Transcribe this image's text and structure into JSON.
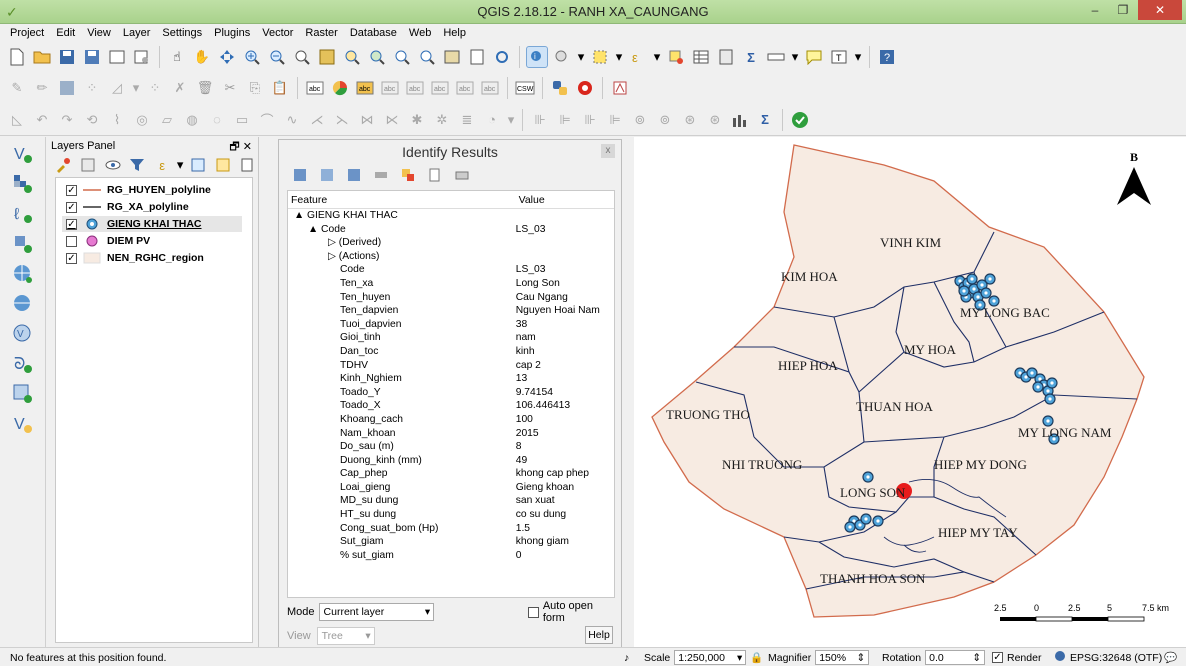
{
  "window": {
    "title": "QGIS 2.18.12 - RANH XA_CAUNGANG",
    "min": "–",
    "max": "❐",
    "close": "✕"
  },
  "menu": [
    "Project",
    "Edit",
    "View",
    "Layer",
    "Settings",
    "Plugins",
    "Vector",
    "Raster",
    "Database",
    "Web",
    "Help"
  ],
  "layers_panel": {
    "title": "Layers Panel",
    "controls": "🗗 ✕",
    "layers": [
      {
        "name": "RG_HUYEN_polyline",
        "checked": true,
        "symbol": "line",
        "color": "#d26b4c"
      },
      {
        "name": "RG_XA_polyline",
        "checked": true,
        "symbol": "line",
        "color": "#333333"
      },
      {
        "name": "GIENG KHAI THAC",
        "checked": true,
        "symbol": "point",
        "color": "#4fa3d9"
      },
      {
        "name": "DIEM PV",
        "checked": false,
        "symbol": "point",
        "color": "#e67ad1"
      },
      {
        "name": "NEN_RGHC_region",
        "checked": true,
        "symbol": "fill",
        "color": "#f7ebe2"
      }
    ]
  },
  "identify": {
    "title": "Identify Results",
    "close": "x",
    "col_feature": "Feature",
    "col_value": "Value",
    "rows": [
      {
        "k": "▲ GIENG KHAI THAC",
        "v": "",
        "indent": 6
      },
      {
        "k": "▲ Code",
        "v": "LS_03",
        "indent": 20
      },
      {
        "k": "▷ (Derived)",
        "v": "",
        "indent": 40
      },
      {
        "k": "▷ (Actions)",
        "v": "",
        "indent": 40
      },
      {
        "k": "Code",
        "v": "LS_03",
        "indent": 52
      },
      {
        "k": "Ten_xa",
        "v": "Long Son",
        "indent": 52
      },
      {
        "k": "Ten_huyen",
        "v": "Cau Ngang",
        "indent": 52
      },
      {
        "k": "Ten_dapvien",
        "v": "Nguyen Hoai Nam",
        "indent": 52
      },
      {
        "k": "Tuoi_dapvien",
        "v": "38",
        "indent": 52
      },
      {
        "k": "Gioi_tinh",
        "v": "nam",
        "indent": 52
      },
      {
        "k": "Dan_toc",
        "v": "kinh",
        "indent": 52
      },
      {
        "k": "TDHV",
        "v": "cap 2",
        "indent": 52
      },
      {
        "k": "Kinh_Nghiem",
        "v": "13",
        "indent": 52
      },
      {
        "k": "Toado_Y",
        "v": "9.74154",
        "indent": 52
      },
      {
        "k": "Toado_X",
        "v": "106.446413",
        "indent": 52
      },
      {
        "k": "Khoang_cach",
        "v": "100",
        "indent": 52
      },
      {
        "k": "Nam_khoan",
        "v": "2015",
        "indent": 52
      },
      {
        "k": "Do_sau (m)",
        "v": "8",
        "indent": 52
      },
      {
        "k": "Duong_kinh (mm)",
        "v": "49",
        "indent": 52
      },
      {
        "k": "Cap_phep",
        "v": "khong cap phep",
        "indent": 52
      },
      {
        "k": "Loai_gieng",
        "v": "Gieng khoan",
        "indent": 52
      },
      {
        "k": "MD_su dung",
        "v": "san xuat",
        "indent": 52
      },
      {
        "k": "HT_su dung",
        "v": "co su dung",
        "indent": 52
      },
      {
        "k": "Cong_suat_bom (Hp)",
        "v": "1.5",
        "indent": 52
      },
      {
        "k": "Sut_giam",
        "v": "khong giam",
        "indent": 52
      },
      {
        "k": "% sut_giam",
        "v": "0",
        "indent": 52
      }
    ],
    "mode_label": "Mode",
    "mode_value": "Current layer",
    "auto_open": "Auto open form",
    "view_label": "View",
    "view_value": "Tree",
    "help": "Help"
  },
  "map": {
    "north": "B",
    "communes": [
      "VINH KIM",
      "KIM HOA",
      "MY LONG BAC",
      "MY HOA",
      "HIEP HOA",
      "THUAN HOA",
      "TRUONG THO",
      "MY LONG NAM",
      "NHI TRUONG",
      "HIEP MY DONG",
      "LONG SON",
      "HIEP MY TAY",
      "THANH HOA SON"
    ],
    "scale_labels": [
      "2.5",
      "0",
      "2.5",
      "5",
      "7.5 km"
    ]
  },
  "status": {
    "message": "No features at this position found.",
    "scale_label": "Scale",
    "scale_value": "1:250,000",
    "magnifier_label": "Magnifier",
    "magnifier_value": "150%",
    "rotation_label": "Rotation",
    "rotation_value": "0.0",
    "render_label": "Render",
    "crs": "EPSG:32648 (OTF)"
  }
}
